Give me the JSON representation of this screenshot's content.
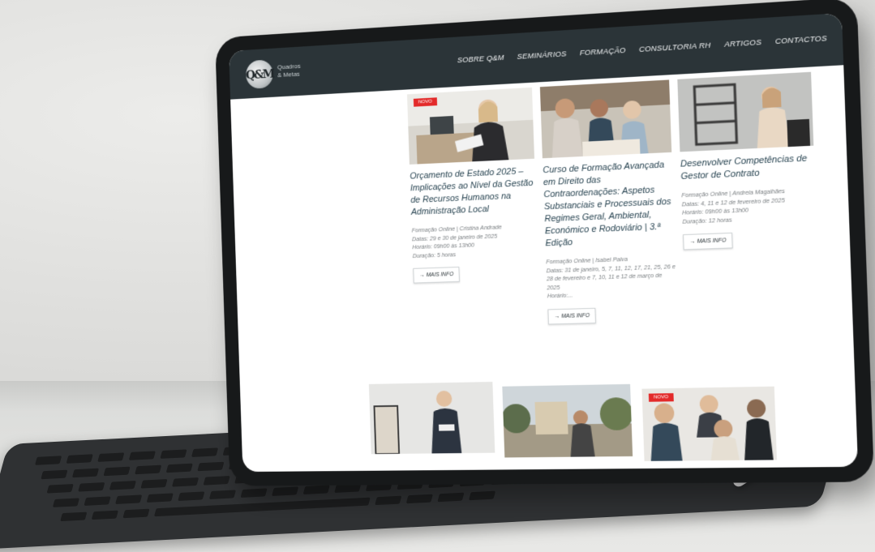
{
  "site": {
    "logo_mark": "Q&M",
    "logo_text_line1": "Quadros",
    "logo_text_line2": "& Metas"
  },
  "nav": [
    "SOBRE Q&M",
    "SEMINÁRIOS",
    "FORMAÇÃO",
    "CONSULTORIA RH",
    "ARTIGOS",
    "CONTACTOS"
  ],
  "cards": [
    {
      "badge": "NOVO",
      "title": "Orçamento de Estado 2025 – Implicações ao Nível da Gestão de Recursos Humanos na Administração Local",
      "meta": [
        "Formação Online | Cristina Andrade",
        "Datas: 29 e 30 de janeiro de 2025",
        "Horário: 09h00 às 13h00",
        "Duração: 5 horas"
      ],
      "button": "→ MAIS INFO"
    },
    {
      "badge": "",
      "title": "Curso de Formação Avançada em Direito das Contraordenações: Aspetos Substanciais e Processuais dos Regimes Geral, Ambiental, Económico e Rodoviário | 3.ª Edição",
      "meta": [
        "Formação Online | Isabel Paiva",
        "Datas: 31 de janeiro, 5, 7, 11, 12, 17, 21, 25, 26 e 28 de fevereiro e 7, 10, 11 e 12 de março de 2025",
        "Horário:..."
      ],
      "button": "→ MAIS INFO"
    },
    {
      "badge": "",
      "title": "Desenvolver Competências de Gestor de Contrato",
      "meta": [
        "Formação Online | Andreia Magalhães",
        "Datas: 4, 11 e 12 de fevereiro de 2025",
        "Horário: 09h00 às 13h00",
        "Duração: 12 horas"
      ],
      "button": "→ MAIS INFO"
    }
  ],
  "bottom_cards": [
    {
      "badge": ""
    },
    {
      "badge": ""
    },
    {
      "badge": "NOVO"
    }
  ],
  "colors": {
    "navbar": "#2b3438",
    "badge": "#e32a2a",
    "title": "#1f3c4a"
  }
}
